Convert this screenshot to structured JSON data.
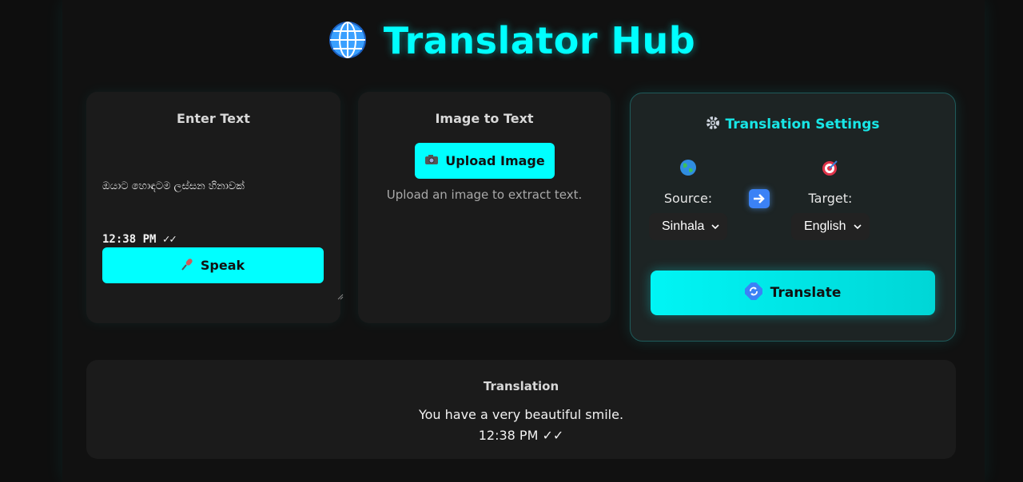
{
  "app": {
    "title": "Translator Hub"
  },
  "input_card": {
    "title": "Enter Text",
    "text_line1": "ඔයාට හොඳටම ලස්සන හිනාවක්",
    "text_line2": "12:38 PM ✓✓",
    "speak_label": "Speak"
  },
  "image_card": {
    "title": "Image to Text",
    "upload_label": "Upload Image",
    "hint": "Upload an image to extract text."
  },
  "settings": {
    "title": "Translation Settings",
    "source_label": "Source:",
    "target_label": "Target:",
    "source_value": "Sinhala",
    "target_value": "English",
    "translate_label": "Translate"
  },
  "result": {
    "title": "Translation",
    "line1": "You have a very beautiful smile.",
    "line2": "12:38 PM ✓✓"
  },
  "colors": {
    "accent": "#00ffff",
    "card": "#1b1b1b",
    "background": "#111111"
  }
}
